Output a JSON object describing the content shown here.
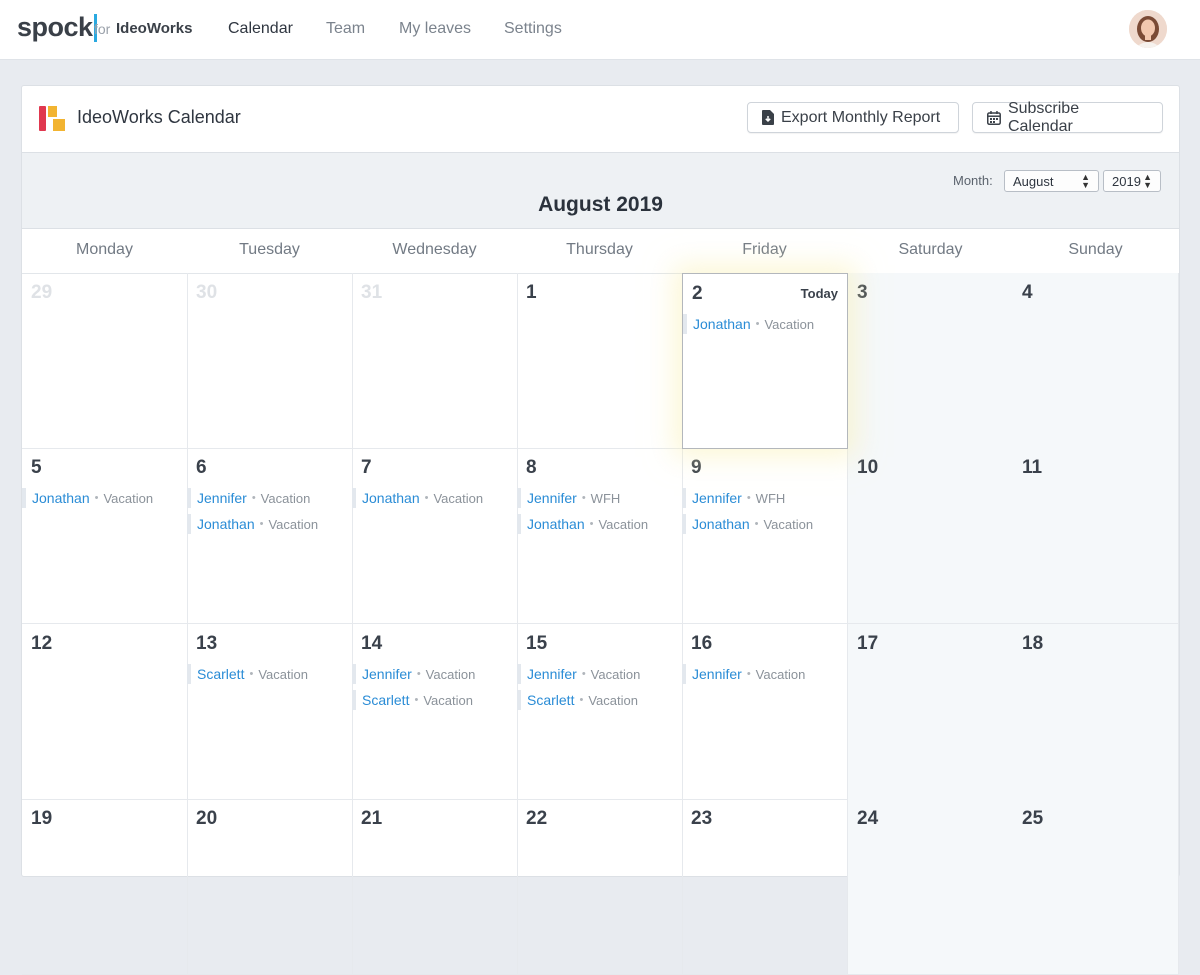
{
  "app": {
    "logo": "spock",
    "for_label": "for",
    "org": "IdeoWorks"
  },
  "nav": [
    {
      "label": "Calendar",
      "active": true
    },
    {
      "label": "Team"
    },
    {
      "label": "My leaves"
    },
    {
      "label": "Settings"
    }
  ],
  "card": {
    "title": "IdeoWorks Calendar",
    "export_label": "Export Monthly Report",
    "subscribe_label": "Subscribe Calendar",
    "month_label": "Month:",
    "month_value": "August",
    "year_value": "2019",
    "calendar_title": "August 2019",
    "today_label": "Today"
  },
  "weekdays": [
    "Monday",
    "Tuesday",
    "Wednesday",
    "Thursday",
    "Friday",
    "Saturday",
    "Sunday"
  ],
  "weeks": [
    [
      {
        "day": "29",
        "muted": true,
        "events": []
      },
      {
        "day": "30",
        "muted": true,
        "events": []
      },
      {
        "day": "31",
        "muted": true,
        "events": []
      },
      {
        "day": "1",
        "events": []
      },
      {
        "day": "2",
        "today": true,
        "events": [
          {
            "name": "Jonathan",
            "type": "Vacation"
          }
        ]
      },
      {
        "day": "3",
        "weekend": true,
        "events": []
      },
      {
        "day": "4",
        "weekend": true,
        "events": []
      }
    ],
    [
      {
        "day": "5",
        "events": [
          {
            "name": "Jonathan",
            "type": "Vacation"
          }
        ]
      },
      {
        "day": "6",
        "events": [
          {
            "name": "Jennifer",
            "type": "Vacation"
          },
          {
            "name": "Jonathan",
            "type": "Vacation"
          }
        ]
      },
      {
        "day": "7",
        "events": [
          {
            "name": "Jonathan",
            "type": "Vacation"
          }
        ]
      },
      {
        "day": "8",
        "events": [
          {
            "name": "Jennifer",
            "type": "WFH"
          },
          {
            "name": "Jonathan",
            "type": "Vacation"
          }
        ]
      },
      {
        "day": "9",
        "events": [
          {
            "name": "Jennifer",
            "type": "WFH"
          },
          {
            "name": "Jonathan",
            "type": "Vacation"
          }
        ]
      },
      {
        "day": "10",
        "weekend": true,
        "events": []
      },
      {
        "day": "11",
        "weekend": true,
        "events": []
      }
    ],
    [
      {
        "day": "12",
        "events": []
      },
      {
        "day": "13",
        "events": [
          {
            "name": "Scarlett",
            "type": "Vacation"
          }
        ]
      },
      {
        "day": "14",
        "events": [
          {
            "name": "Jennifer",
            "type": "Vacation"
          },
          {
            "name": "Scarlett",
            "type": "Vacation"
          }
        ]
      },
      {
        "day": "15",
        "events": [
          {
            "name": "Jennifer",
            "type": "Vacation"
          },
          {
            "name": "Scarlett",
            "type": "Vacation"
          }
        ]
      },
      {
        "day": "16",
        "events": [
          {
            "name": "Jennifer",
            "type": "Vacation"
          }
        ]
      },
      {
        "day": "17",
        "weekend": true,
        "events": []
      },
      {
        "day": "18",
        "weekend": true,
        "events": []
      }
    ],
    [
      {
        "day": "19",
        "events": []
      },
      {
        "day": "20",
        "events": []
      },
      {
        "day": "21",
        "events": []
      },
      {
        "day": "22",
        "events": []
      },
      {
        "day": "23",
        "events": []
      },
      {
        "day": "24",
        "weekend": true,
        "events": []
      },
      {
        "day": "25",
        "weekend": true,
        "events": []
      }
    ]
  ],
  "colors": {
    "accent": "#2a8cd6",
    "brand_red": "#e0384f",
    "brand_yellow": "#f2b431",
    "logo_bar": "#2aa9e0"
  }
}
